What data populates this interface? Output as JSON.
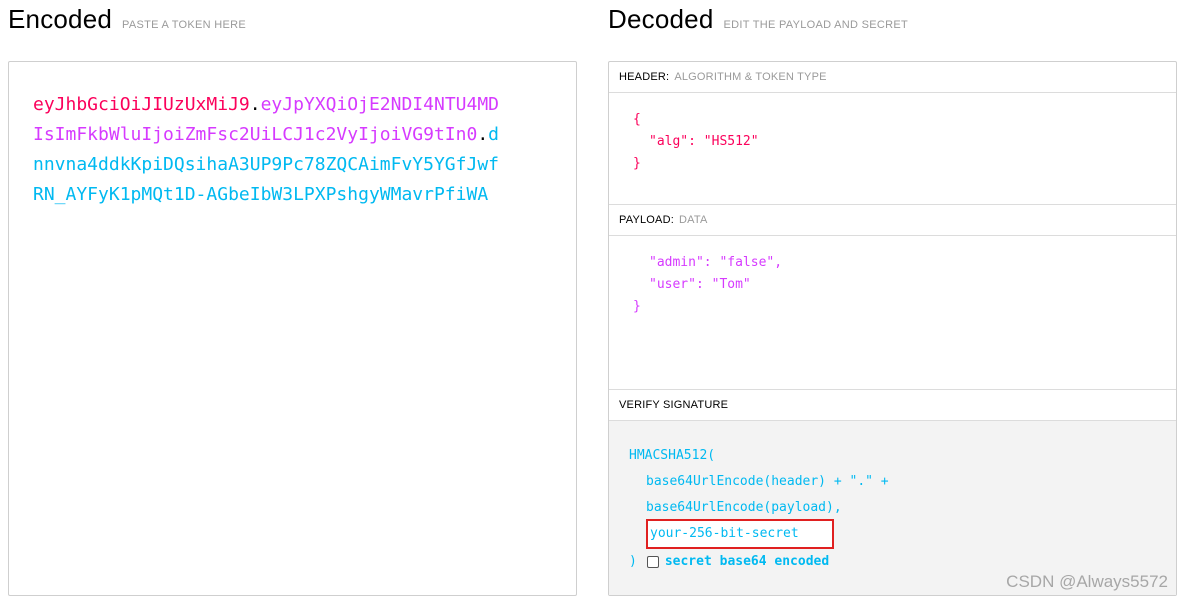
{
  "encoded": {
    "title": "Encoded",
    "subtitle": "PASTE A TOKEN HERE",
    "token": {
      "header_part": "eyJhbGciOiJIUzUxMiJ9",
      "dot1": ".",
      "payload_part": "eyJpYXQiOjE2NDI4NTU4MDIsImFkbWluIjoiZmFsc2UiLCJ1c2VyIjoiVG9tIn0",
      "dot2": ".",
      "signature_part": "dnnvna4ddkKpiDQsihaA3UP9Pc78ZQCAimFvY5YGfJwfRN_AYFyK1pMQt1D-AGbeIbW3LPXPshgyWMavrPfiWA"
    }
  },
  "decoded": {
    "title": "Decoded",
    "subtitle": "EDIT THE PAYLOAD AND SECRET",
    "header_section": {
      "label": "HEADER:",
      "sublabel": "ALGORITHM & TOKEN TYPE",
      "open_brace": "{",
      "line1": "\"alg\": \"HS512\"",
      "close_brace": "}"
    },
    "payload_section": {
      "label": "PAYLOAD:",
      "sublabel": "DATA",
      "line1": "\"admin\": \"false\",",
      "line2": "\"user\": \"Tom\"",
      "close_brace": "}"
    },
    "signature_section": {
      "label": "VERIFY SIGNATURE",
      "fn_open": "HMACSHA512(",
      "line1": "base64UrlEncode(header) + \".\" +",
      "line2": "base64UrlEncode(payload),",
      "secret_value": "your-256-bit-secret",
      "close_paren": ")",
      "checkbox_label": "secret base64 encoded",
      "checkbox_checked": false
    }
  },
  "watermark": "CSDN @Always5572",
  "colors": {
    "header": "#fb015b",
    "payload": "#d63aff",
    "signature": "#00b9f1",
    "highlight_border": "#e02020"
  }
}
